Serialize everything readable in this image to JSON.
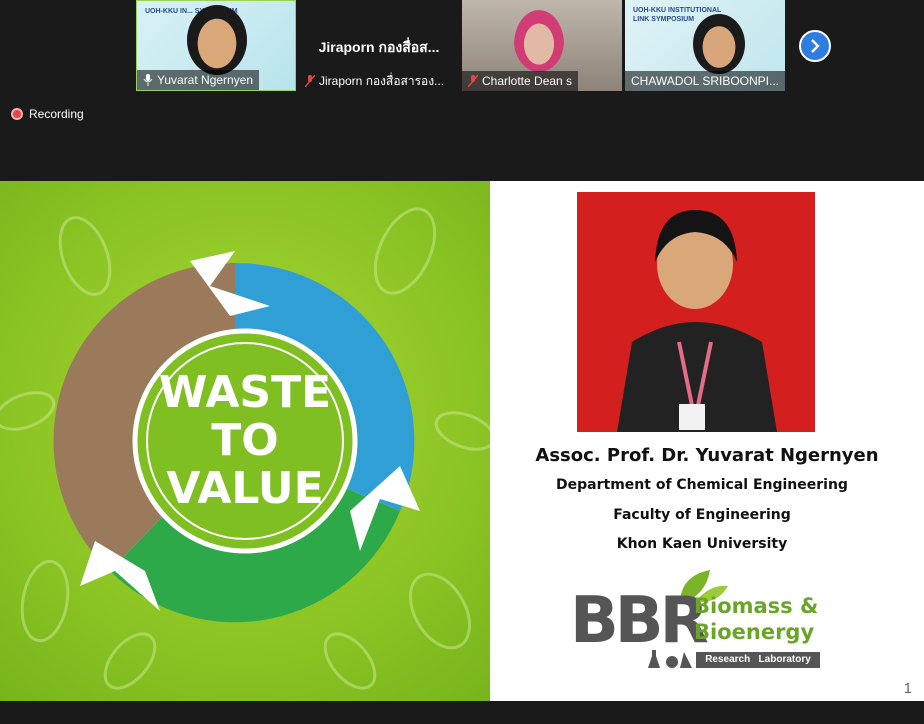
{
  "participants": [
    {
      "name": "Yuvarat Ngernyen",
      "mic_status": "speaking",
      "banner": "UOH-KKU IN... SYMPOSIUM"
    },
    {
      "name": "Jiraporn กองสื่อสารอง...",
      "display_name": "Jiraporn กองสื่อส...",
      "mic_status": "muted"
    },
    {
      "name": "Charlotte Dean s",
      "mic_status": "muted"
    },
    {
      "name": "CHAWADOL SRIBOONPI...",
      "mic_status": "none",
      "banner": "UOH-KKU INSTITUTIONAL LINK SYMPOSIUM"
    }
  ],
  "recording": {
    "label": "Recording"
  },
  "slide": {
    "badge_lines": [
      "WASTE",
      "TO",
      "VALUE"
    ],
    "speaker_name": "Assoc. Prof. Dr. Yuvarat Ngernyen",
    "department": "Department of Chemical Engineering",
    "faculty": "Faculty of Engineering",
    "university": "Khon Kaen University",
    "logo": {
      "initials": "BBR",
      "line1": "Biomass &",
      "line2": "Bioenergy",
      "footer": "Research   Laboratory"
    },
    "page_number": "1"
  },
  "colors": {
    "accent_green": "#7fbf22",
    "tile_border": "#9bd25a",
    "next_button": "#2e7de0",
    "record_dot": "#e04848"
  }
}
